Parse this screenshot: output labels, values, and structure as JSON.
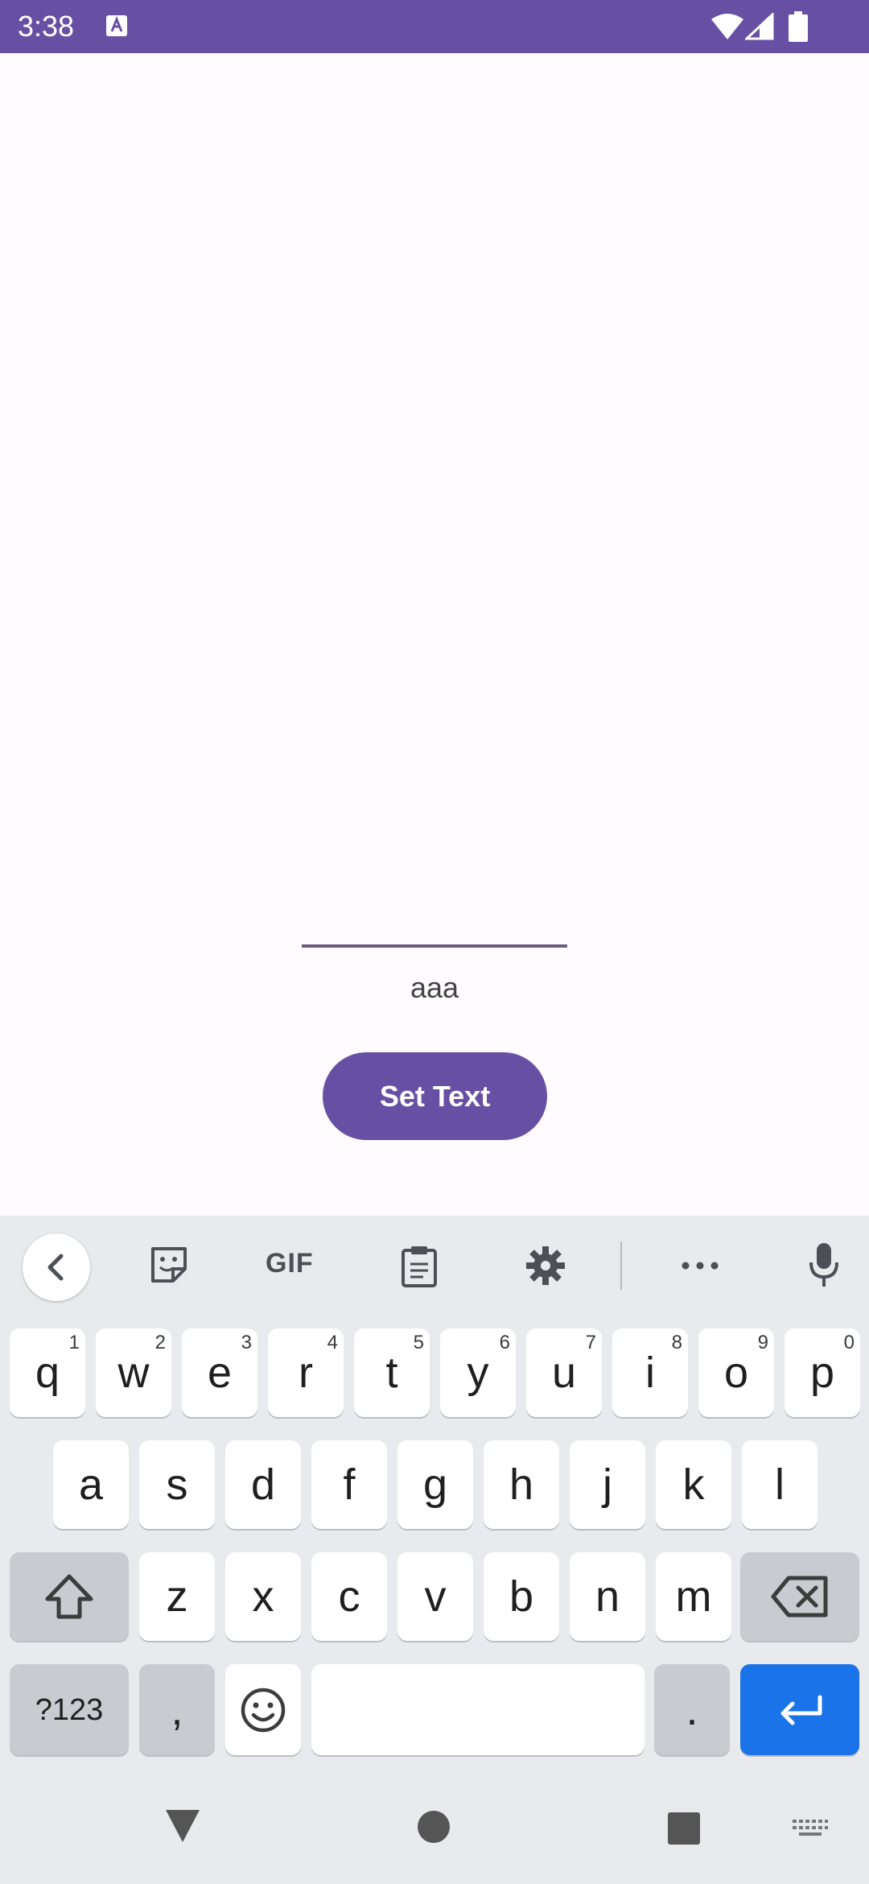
{
  "status_bar": {
    "time": "3:38",
    "colors": {
      "bar": "#6750a4"
    }
  },
  "app": {
    "display_text": "aaa",
    "set_button_label": "Set Text",
    "accent": "#6750a4"
  },
  "keyboard": {
    "toolbar": {
      "gif_label": "GIF",
      "icons": [
        "back-chevron",
        "sticker",
        "gif",
        "clipboard",
        "settings",
        "more",
        "microphone"
      ]
    },
    "row1": [
      {
        "key": "q",
        "hint": "1"
      },
      {
        "key": "w",
        "hint": "2"
      },
      {
        "key": "e",
        "hint": "3"
      },
      {
        "key": "r",
        "hint": "4"
      },
      {
        "key": "t",
        "hint": "5"
      },
      {
        "key": "y",
        "hint": "6"
      },
      {
        "key": "u",
        "hint": "7"
      },
      {
        "key": "i",
        "hint": "8"
      },
      {
        "key": "o",
        "hint": "9"
      },
      {
        "key": "p",
        "hint": "0"
      }
    ],
    "row2": [
      "a",
      "s",
      "d",
      "f",
      "g",
      "h",
      "j",
      "k",
      "l"
    ],
    "row3": [
      "z",
      "x",
      "c",
      "v",
      "b",
      "n",
      "m"
    ],
    "row4": {
      "symbols": "?123",
      "comma": ",",
      "period": "."
    },
    "enter_color": "#1a73e8"
  }
}
